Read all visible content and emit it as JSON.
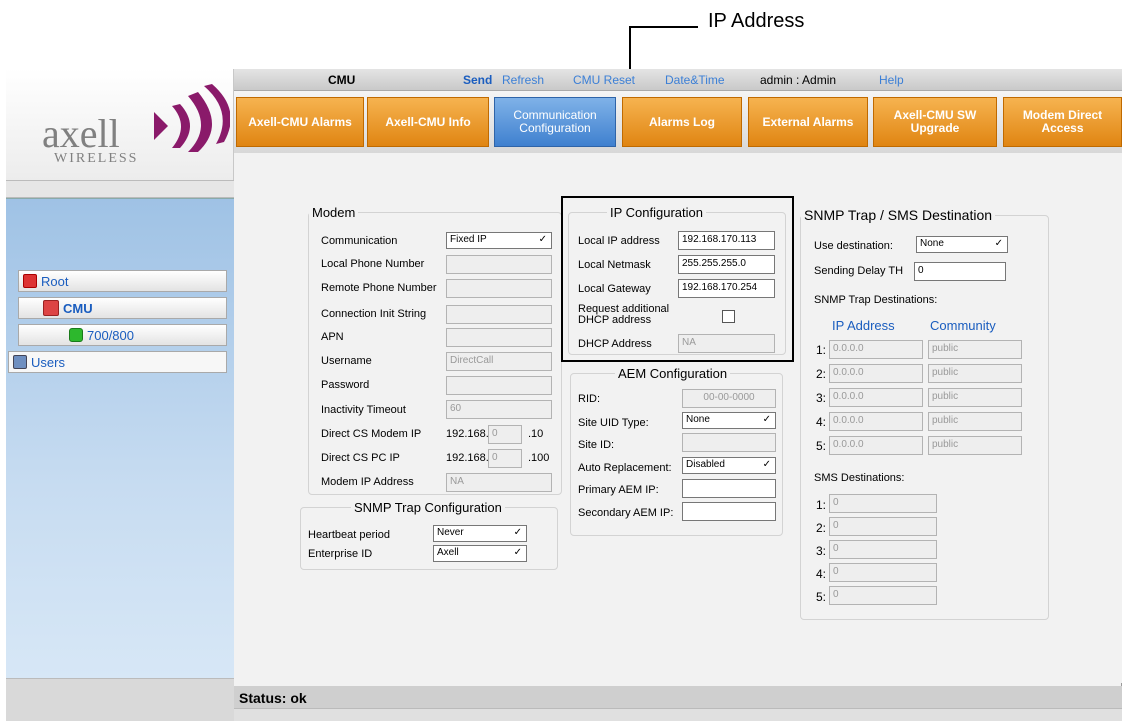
{
  "callout": {
    "label": "IP Address"
  },
  "logo": {
    "name": "axell",
    "sub": "WIRELESS"
  },
  "topbar": {
    "device": "CMU",
    "send": "Send",
    "refresh": "Refresh",
    "reset": "CMU Reset",
    "datetime": "Date&Time",
    "user": "admin : Admin",
    "help": "Help"
  },
  "tabs": [
    {
      "label": "Axell-CMU Alarms"
    },
    {
      "label": "Axell-CMU Info"
    },
    {
      "label": "Communication Configuration"
    },
    {
      "label": "Alarms Log"
    },
    {
      "label": "External Alarms"
    },
    {
      "label": "Axell-CMU SW Upgrade"
    },
    {
      "label": "Modem Direct Access"
    }
  ],
  "tree": [
    {
      "label": "Root"
    },
    {
      "label": "CMU"
    },
    {
      "label": "700/800"
    },
    {
      "label": "Users"
    }
  ],
  "modem": {
    "title": "Modem",
    "communication_label": "Communication",
    "communication_value": "Fixed IP",
    "local_phone_label": "Local Phone Number",
    "remote_phone_label": "Remote Phone Number",
    "conn_init_label": "Connection Init String",
    "apn_label": "APN",
    "username_label": "Username",
    "username_value": "DirectCall",
    "password_label": "Password",
    "inactivity_label": "Inactivity Timeout",
    "inactivity_value": "60",
    "cs_modem_ip_label": "Direct CS Modem IP",
    "cs_modem_ip_prefix": "192.168.",
    "cs_modem_ip_octet": "0",
    "cs_modem_ip_suffix": ".10",
    "cs_pc_ip_label": "Direct CS PC IP",
    "cs_pc_ip_prefix": "192.168.",
    "cs_pc_ip_octet": "0",
    "cs_pc_ip_suffix": ".100",
    "modem_ip_label": "Modem IP Address",
    "modem_ip_value": "NA"
  },
  "snmp_trap_config": {
    "title": "SNMP Trap Configuration",
    "heartbeat_label": "Heartbeat period",
    "heartbeat_value": "Never",
    "enterprise_label": "Enterprise ID",
    "enterprise_value": "Axell"
  },
  "ip_config": {
    "title": "IP Configuration",
    "local_ip_label": "Local IP address",
    "local_ip_value": "192.168.170.113",
    "netmask_label": "Local Netmask",
    "netmask_value": "255.255.255.0",
    "gateway_label": "Local Gateway",
    "gateway_value": "192.168.170.254",
    "dhcp_request_label_1": "Request additional",
    "dhcp_request_label_2": "DHCP address",
    "dhcp_address_label": "DHCP Address",
    "dhcp_address_value": "NA"
  },
  "aem_config": {
    "title": "AEM Configuration",
    "rid_label": "RID:",
    "rid_value": "00-00-0000",
    "site_uid_type_label": "Site UID Type:",
    "site_uid_type_value": "None",
    "site_id_label": "Site ID:",
    "auto_replacement_label": "Auto Replacement:",
    "auto_replacement_value": "Disabled",
    "primary_aem_label": "Primary AEM IP:",
    "secondary_aem_label": "Secondary AEM IP:"
  },
  "snmp_dest": {
    "title": "SNMP Trap / SMS Destination",
    "use_dest_label": "Use destination:",
    "use_dest_value": "None",
    "delay_label": "Sending Delay TH",
    "delay_value": "0",
    "trap_dest_label": "SNMP Trap Destinations:",
    "ip_header": "IP Address",
    "community_header": "Community",
    "destinations": [
      {
        "num": "1:",
        "ip": "0.0.0.0",
        "community": "public"
      },
      {
        "num": "2:",
        "ip": "0.0.0.0",
        "community": "public"
      },
      {
        "num": "3:",
        "ip": "0.0.0.0",
        "community": "public"
      },
      {
        "num": "4:",
        "ip": "0.0.0.0",
        "community": "public"
      },
      {
        "num": "5:",
        "ip": "0.0.0.0",
        "community": "public"
      }
    ],
    "sms_label": "SMS Destinations:",
    "sms": [
      {
        "num": "1:",
        "value": "0"
      },
      {
        "num": "2:",
        "value": "0"
      },
      {
        "num": "3:",
        "value": "0"
      },
      {
        "num": "4:",
        "value": "0"
      },
      {
        "num": "5:",
        "value": "0"
      }
    ]
  },
  "status": {
    "text": "Status: ok"
  },
  "colors": {
    "tab_orange": "#e8901c",
    "tab_active_blue": "#4f8ad6",
    "link_blue": "#1a5dbf",
    "nav_blue": "#b3d0ee"
  }
}
